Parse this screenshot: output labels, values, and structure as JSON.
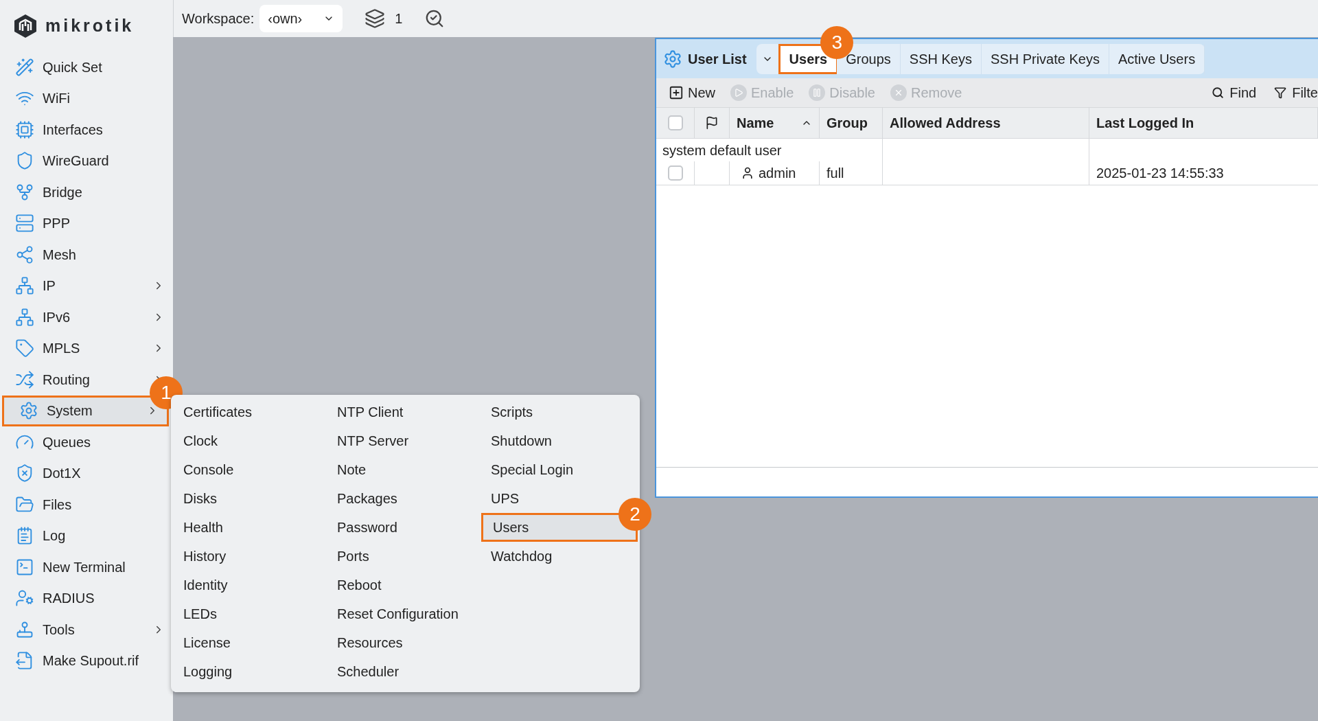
{
  "logo": {
    "text": "mikrotik"
  },
  "topbar": {
    "workspace_label": "Workspace:",
    "workspace_value": "‹own›",
    "window_count": "1"
  },
  "sidebar": {
    "items": [
      {
        "label": "Quick Set",
        "submenu": false,
        "selected": false
      },
      {
        "label": "WiFi",
        "submenu": false,
        "selected": false
      },
      {
        "label": "Interfaces",
        "submenu": false,
        "selected": false
      },
      {
        "label": "WireGuard",
        "submenu": false,
        "selected": false
      },
      {
        "label": "Bridge",
        "submenu": false,
        "selected": false
      },
      {
        "label": "PPP",
        "submenu": false,
        "selected": false
      },
      {
        "label": "Mesh",
        "submenu": false,
        "selected": false
      },
      {
        "label": "IP",
        "submenu": true,
        "selected": false
      },
      {
        "label": "IPv6",
        "submenu": true,
        "selected": false
      },
      {
        "label": "MPLS",
        "submenu": true,
        "selected": false
      },
      {
        "label": "Routing",
        "submenu": true,
        "selected": false
      },
      {
        "label": "System",
        "submenu": true,
        "selected": true,
        "callout": "1"
      },
      {
        "label": "Queues",
        "submenu": false,
        "selected": false
      },
      {
        "label": "Dot1X",
        "submenu": false,
        "selected": false
      },
      {
        "label": "Files",
        "submenu": false,
        "selected": false
      },
      {
        "label": "Log",
        "submenu": false,
        "selected": false
      },
      {
        "label": "New Terminal",
        "submenu": false,
        "selected": false
      },
      {
        "label": "RADIUS",
        "submenu": false,
        "selected": false
      },
      {
        "label": "Tools",
        "submenu": true,
        "selected": false
      },
      {
        "label": "Make Supout.rif",
        "submenu": false,
        "selected": false
      }
    ]
  },
  "system_menu": {
    "columns": [
      [
        {
          "label": "Certificates",
          "selected": false
        },
        {
          "label": "Clock",
          "selected": false
        },
        {
          "label": "Console",
          "selected": false
        },
        {
          "label": "Disks",
          "selected": false
        },
        {
          "label": "Health",
          "selected": false
        },
        {
          "label": "History",
          "selected": false
        },
        {
          "label": "Identity",
          "selected": false
        },
        {
          "label": "LEDs",
          "selected": false
        },
        {
          "label": "License",
          "selected": false
        },
        {
          "label": "Logging",
          "selected": false
        }
      ],
      [
        {
          "label": "NTP Client",
          "selected": false
        },
        {
          "label": "NTP Server",
          "selected": false
        },
        {
          "label": "Note",
          "selected": false
        },
        {
          "label": "Packages",
          "selected": false
        },
        {
          "label": "Password",
          "selected": false
        },
        {
          "label": "Ports",
          "selected": false
        },
        {
          "label": "Reboot",
          "selected": false
        },
        {
          "label": "Reset Configuration",
          "selected": false
        },
        {
          "label": "Resources",
          "selected": false
        },
        {
          "label": "Scheduler",
          "selected": false
        }
      ],
      [
        {
          "label": "Scripts",
          "selected": false
        },
        {
          "label": "Shutdown",
          "selected": false
        },
        {
          "label": "Special Login",
          "selected": false
        },
        {
          "label": "UPS",
          "selected": false
        },
        {
          "label": "Users",
          "selected": true,
          "callout": "2"
        },
        {
          "label": "Watchdog",
          "selected": false
        }
      ]
    ]
  },
  "user_list": {
    "title": "User List",
    "tabs": [
      {
        "label": "Users",
        "selected": true,
        "callout": "3"
      },
      {
        "label": "Groups",
        "selected": false
      },
      {
        "label": "SSH Keys",
        "selected": false
      },
      {
        "label": "SSH Private Keys",
        "selected": false
      },
      {
        "label": "Active Users",
        "selected": false
      }
    ],
    "actions": [
      {
        "label": "New",
        "disabled": false
      },
      {
        "label": "Enable",
        "disabled": true
      },
      {
        "label": "Disable",
        "disabled": true
      },
      {
        "label": "Remove",
        "disabled": true
      }
    ],
    "find": "Find",
    "filter": "Filte",
    "columns": [
      {
        "label": "Name",
        "sorted": true
      },
      {
        "label": "Group",
        "sorted": false
      },
      {
        "label": "Allowed Address",
        "sorted": false
      },
      {
        "label": "Last Logged In",
        "sorted": false
      }
    ],
    "select_all_checked": false,
    "groups": [
      {
        "label": "system default user",
        "rows": [
          {
            "checked": false,
            "name": "admin",
            "group": "full",
            "last_logged_in": "2025-01-23 14:55:33"
          }
        ]
      }
    ]
  }
}
